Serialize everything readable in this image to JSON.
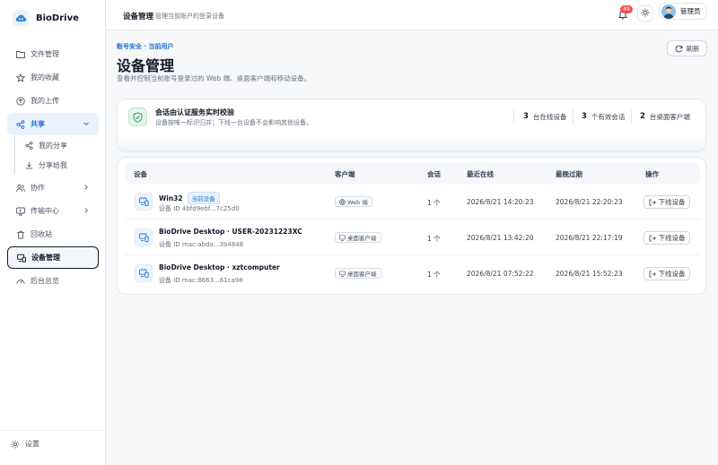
{
  "app": {
    "name": "BioDrive"
  },
  "sidebar": {
    "items": [
      {
        "label": "文件管理",
        "icon": "folder-icon"
      },
      {
        "label": "我的收藏",
        "icon": "star-icon"
      },
      {
        "label": "我的上传",
        "icon": "upload-icon"
      },
      {
        "label": "共享",
        "icon": "share-icon",
        "expanded": true
      },
      {
        "label": "我的分享",
        "icon": "share-small-icon"
      },
      {
        "label": "分享给我",
        "icon": "download-icon"
      },
      {
        "label": "协作",
        "icon": "users-icon"
      },
      {
        "label": "传输中心",
        "icon": "transfer-icon"
      },
      {
        "label": "回收站",
        "icon": "trash-icon"
      },
      {
        "label": "设备管理",
        "icon": "devices-icon",
        "active": true
      },
      {
        "label": "后台总览",
        "icon": "gauge-icon"
      }
    ],
    "settings_label": "设置"
  },
  "header": {
    "title": "设备管理",
    "subtitle": "管理当前账户的登录设备",
    "notification_count": "49",
    "user_name": "管理员"
  },
  "page": {
    "breadcrumb": "账号安全 · 当前用户",
    "title": "设备管理",
    "description": "查看并控制当前账号登录过的 Web 端、桌面客户端和移动设备。",
    "refresh_label": "刷新"
  },
  "status": {
    "title": "会话由认证服务实时校验",
    "subtitle": "设备按唯一标识归并；下线一台设备不会影响其他设备。",
    "stats": [
      {
        "value": "3",
        "label": "台在线设备"
      },
      {
        "value": "3",
        "label": "个有效会话"
      },
      {
        "value": "2",
        "label": "台桌面客户端"
      }
    ]
  },
  "table": {
    "columns": [
      "设备",
      "客户端",
      "会话",
      "最近在线",
      "最晚过期",
      "操作"
    ],
    "rows": [
      {
        "name": "Win32",
        "current_badge": "当前设备",
        "id": "设备 ID 4bfd9ebf...7c25d0",
        "client": "Web 端",
        "sessions": "1 个",
        "last_online": "2026/8/21 14:20:23",
        "expires": "2026/8/21 22:20:23",
        "action": "下线设备"
      },
      {
        "name": "BioDrive Desktop · USER-20231223XC",
        "current_badge": "",
        "id": "设备 ID mac:abda...3b4848",
        "client": "桌面客户端",
        "sessions": "1 个",
        "last_online": "2026/8/21 13:42:20",
        "expires": "2026/8/21 22:17:19",
        "action": "下线设备"
      },
      {
        "name": "BioDrive Desktop · xztcomputer",
        "current_badge": "",
        "id": "设备 ID mac:8663...61ca98",
        "client": "桌面客户端",
        "sessions": "1 个",
        "last_online": "2026/8/21 07:52:22",
        "expires": "2026/8/21 15:52:23",
        "action": "下线设备"
      }
    ]
  },
  "colors": {
    "accent": "#1f6fd1",
    "badge": "#ef5350",
    "success": "#2e9e63"
  }
}
